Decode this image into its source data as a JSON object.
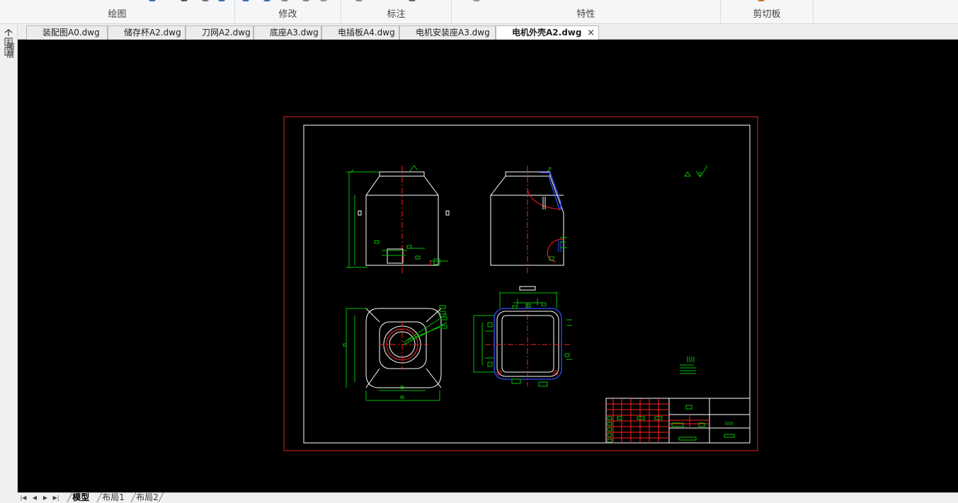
{
  "ribbon": {
    "groups": [
      {
        "label": "绘图"
      },
      {
        "label": "修改"
      },
      {
        "label": "标注"
      },
      {
        "label": "特性"
      },
      {
        "label": "剪切板"
      }
    ]
  },
  "side_panel": {
    "label": "图层"
  },
  "document_tabs": [
    {
      "label": "装配图A0.dwg",
      "active": false
    },
    {
      "label": "储存杯A2.dwg",
      "active": false
    },
    {
      "label": "刀网A2.dwg",
      "active": false
    },
    {
      "label": "底座A3.dwg",
      "active": false
    },
    {
      "label": "电插板A4.dwg",
      "active": false
    },
    {
      "label": "电机安装座A3.dwg",
      "active": false
    },
    {
      "label": "电机外壳A2.dwg",
      "active": true
    }
  ],
  "close_glyph": "×",
  "layout_tabs": [
    {
      "label": "模型",
      "active": true
    },
    {
      "label": "布局1",
      "active": false
    },
    {
      "label": "布局2",
      "active": false
    }
  ],
  "nav_glyphs": [
    "|◀",
    "◀",
    "▶",
    "▶|"
  ],
  "colors": {
    "canvas_bg": "#000000",
    "frame_outer": "#e02020",
    "frame_inner": "#ffffff",
    "dimension": "#00c000",
    "centerline": "#ff2020",
    "section": "#3050ff"
  }
}
